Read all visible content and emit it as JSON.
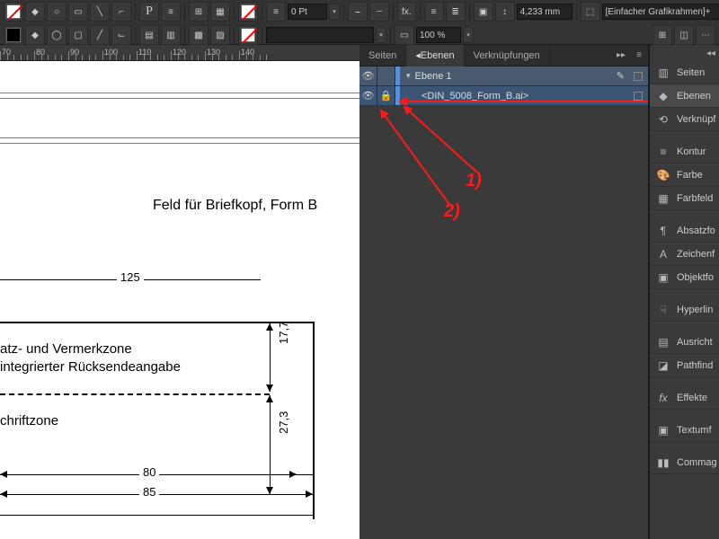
{
  "toolbar": {
    "stroke_pt": "0 Pt",
    "zoom": "100 %",
    "measure": "4,233 mm",
    "style_preset": "[Einfacher Grafikrahmen]+",
    "fx_label": "fx."
  },
  "ruler": {
    "marks": [
      {
        "pos": 0,
        "label": "70"
      },
      {
        "pos": 38,
        "label": "80"
      },
      {
        "pos": 76,
        "label": "90"
      },
      {
        "pos": 114,
        "label": "100"
      },
      {
        "pos": 152,
        "label": "110"
      },
      {
        "pos": 190,
        "label": "120"
      },
      {
        "pos": 228,
        "label": "130"
      },
      {
        "pos": 266,
        "label": "140"
      }
    ]
  },
  "document": {
    "headline": "Feld für Briefkopf, Form B",
    "zone1_line1": "atz- und Vermerkzone",
    "zone1_line2": "integrierter Rücksendeangabe",
    "zone2": "chriftzone",
    "dim_125": "125",
    "dim_17_7": "17,7",
    "dim_27_3": "27,3",
    "dim_80": "80",
    "dim_85": "85"
  },
  "panel": {
    "tab_pages": "Seiten",
    "tab_layers": "Ebenen",
    "tab_links": "Verknüpfungen",
    "layer1": "Ebene 1",
    "sublayer": "<DIN_5008_Form_B.ai>"
  },
  "annotations": {
    "a1": "1)",
    "a2": "2)"
  },
  "dock": {
    "pages": "Seiten",
    "layers": "Ebenen",
    "links": "Verknüpf",
    "stroke": "Kontur",
    "color": "Farbe",
    "swatches": "Farbfeld",
    "para": "Absatzfo",
    "char": "Zeichenf",
    "object": "Objektfo",
    "hyperlinks": "Hyperlin",
    "align": "Ausricht",
    "pathfinder": "Pathfind",
    "effects": "Effekte",
    "textwrap": "Textumf",
    "cclibs": "Commag"
  }
}
